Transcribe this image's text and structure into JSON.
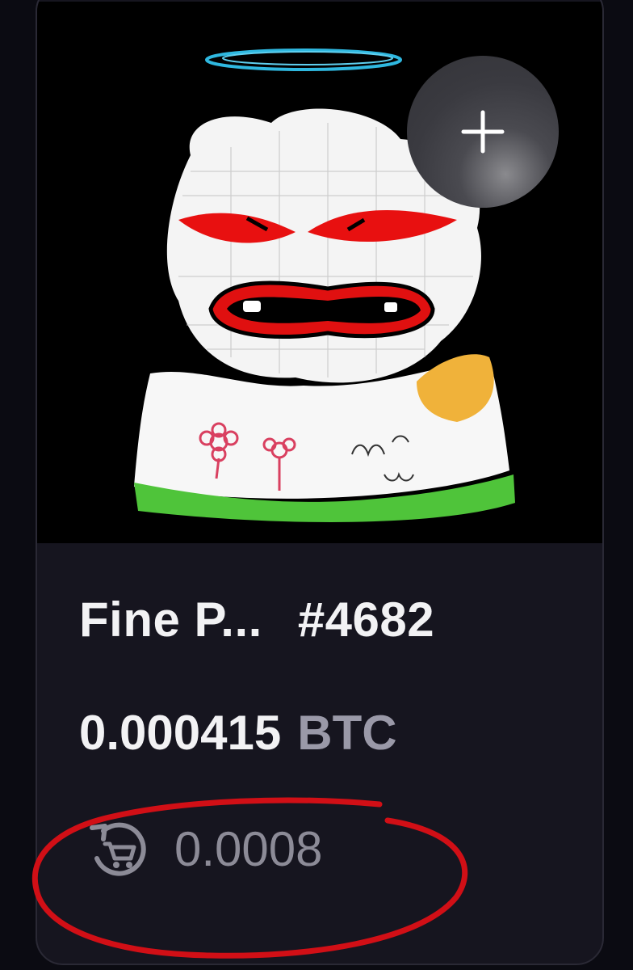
{
  "item": {
    "name": "Fine P...",
    "number": "#4682"
  },
  "price": {
    "value": "0.000415",
    "unit": "BTC"
  },
  "last_sale": {
    "icon": "cart-history-icon",
    "value": "0.0008"
  },
  "actions": {
    "add_icon": "plus-icon"
  },
  "colors": {
    "card_bg": "#16151f",
    "text_primary": "#f2f2f4",
    "text_muted": "#9a99a8",
    "annotation_red": "#d10f16"
  }
}
